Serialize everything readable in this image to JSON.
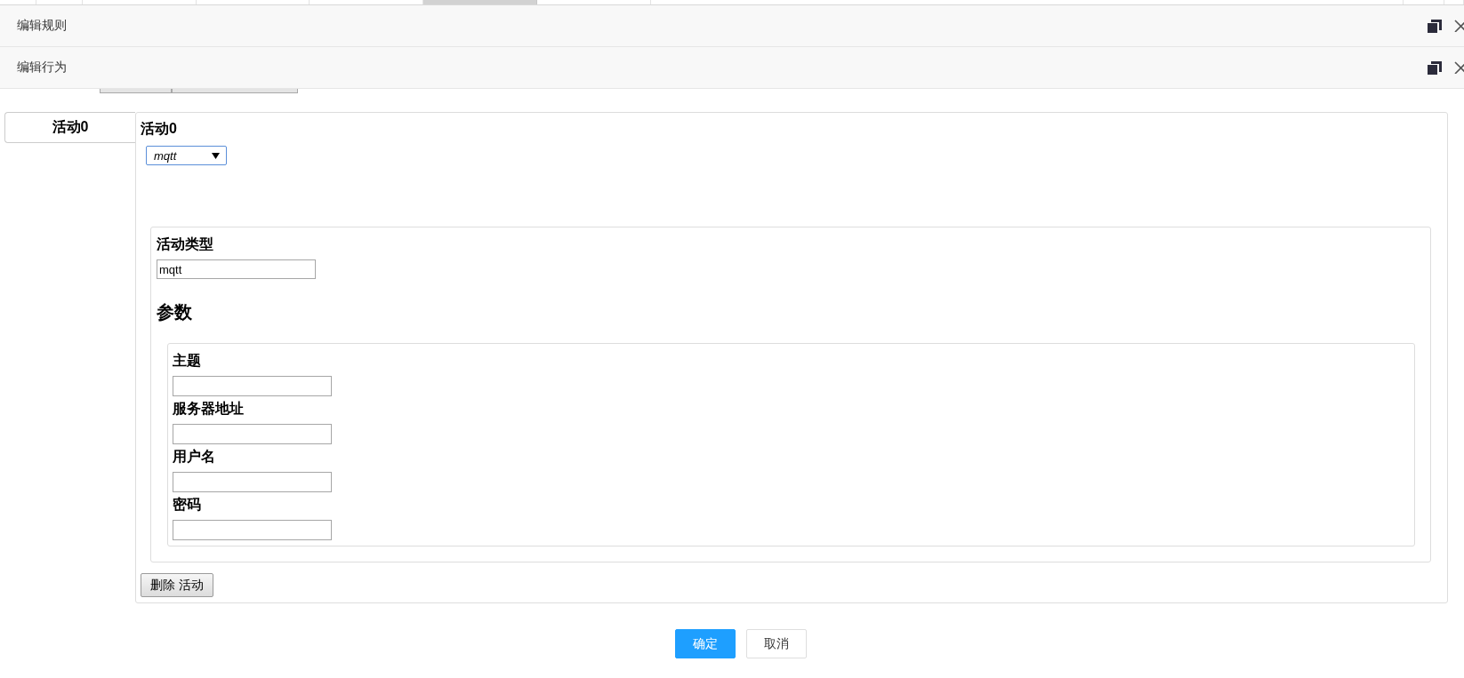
{
  "window_tabs": [
    {
      "selected": false
    },
    {
      "selected": false
    },
    {
      "selected": false
    },
    {
      "selected": false
    },
    {
      "selected": false
    },
    {
      "selected": true
    },
    {
      "selected": false
    },
    {
      "selected": false
    },
    {
      "selected": false
    },
    {
      "selected": false
    }
  ],
  "dialogs": [
    {
      "title": "编辑规则"
    },
    {
      "title": "编辑行为"
    }
  ],
  "activity_tabs": [
    {
      "label": "活动0",
      "selected": true
    }
  ],
  "activity": {
    "heading": "活动0",
    "type_select": {
      "value": "mqtt"
    },
    "type_field": {
      "label": "活动类型",
      "value": "mqtt"
    },
    "params_heading": "参数",
    "params": [
      {
        "label": "主题"
      },
      {
        "label": "服务器地址"
      },
      {
        "label": "用户名"
      },
      {
        "label": "密码"
      }
    ],
    "delete_button": "删除 活动"
  },
  "footer_buttons": [
    {
      "label": "确定",
      "kind": "primary"
    },
    {
      "label": "取消",
      "kind": "default"
    }
  ]
}
